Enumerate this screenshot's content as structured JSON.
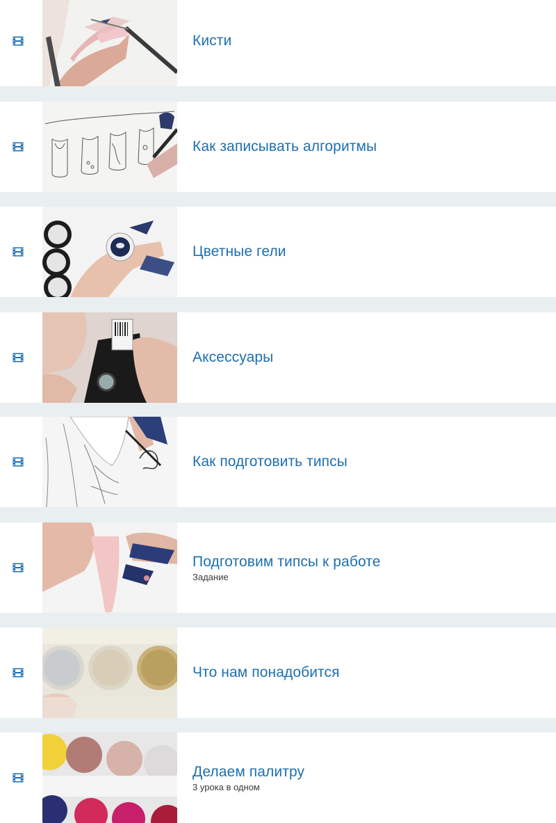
{
  "lessons": [
    {
      "title": "Кисти",
      "subtitle": "",
      "icon": "film-icon",
      "thumb": "brush-nail-thumbnail"
    },
    {
      "title": "Как записывать алгоритмы",
      "subtitle": "",
      "icon": "film-icon",
      "thumb": "nail-sketch-thumbnail"
    },
    {
      "title": "Цветные гели",
      "subtitle": "",
      "icon": "film-icon",
      "thumb": "gel-jars-thumbnail"
    },
    {
      "title": "Аксессуары",
      "subtitle": "",
      "icon": "film-icon",
      "thumb": "accessory-tool-thumbnail"
    },
    {
      "title": "Как подготовить типсы",
      "subtitle": "",
      "icon": "film-icon",
      "thumb": "tips-drawing-thumbnail"
    },
    {
      "title": "Подготовим типсы к работе",
      "subtitle": "Задание",
      "icon": "film-icon",
      "thumb": "pink-tip-thumbnail"
    },
    {
      "title": "Что нам понадобится",
      "subtitle": "",
      "icon": "film-icon",
      "thumb": "glitter-palette-thumbnail"
    },
    {
      "title": "Делаем палитру",
      "subtitle": "3 урока в одном",
      "icon": "film-icon",
      "thumb": "color-palette-thumbnail"
    }
  ],
  "colors": {
    "title": "#1d6fb2",
    "icon": "#1d6fb2",
    "separator": "#e9eef0",
    "row": "#ffffff"
  }
}
